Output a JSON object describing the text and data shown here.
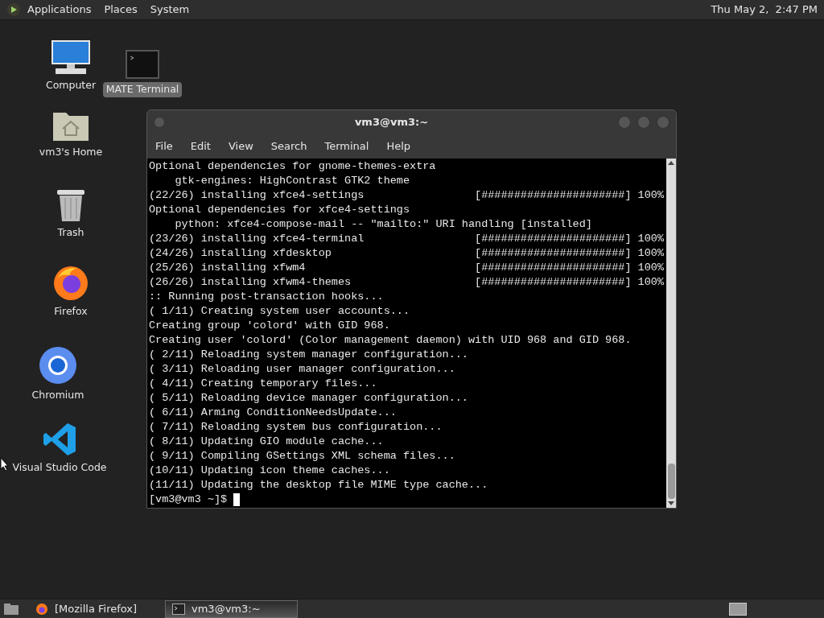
{
  "top_panel": {
    "menus": [
      "Applications",
      "Places",
      "System"
    ],
    "clock": "Thu May 2,  2:47 PM"
  },
  "desktop_icons": [
    {
      "kind": "computer",
      "label": "Computer",
      "selected": false
    },
    {
      "kind": "terminal",
      "label": "MATE Terminal",
      "selected": true
    },
    {
      "kind": "home",
      "label": "vm3's Home",
      "selected": false
    },
    {
      "kind": "trash",
      "label": "Trash",
      "selected": false
    },
    {
      "kind": "firefox",
      "label": "Firefox",
      "selected": false
    },
    {
      "kind": "chromium",
      "label": "Chromium",
      "selected": false
    },
    {
      "kind": "vscode",
      "label": "Visual Studio Code",
      "selected": false
    }
  ],
  "terminal_window": {
    "title": "vm3@vm3:~",
    "menu": [
      "File",
      "Edit",
      "View",
      "Search",
      "Terminal",
      "Help"
    ],
    "lines": [
      "Optional dependencies for gnome-themes-extra",
      "    gtk-engines: HighContrast GTK2 theme",
      "(22/26) installing xfce4-settings                 [######################] 100%",
      "Optional dependencies for xfce4-settings",
      "    python: xfce4-compose-mail -- \"mailto:\" URI handling [installed]",
      "(23/26) installing xfce4-terminal                 [######################] 100%",
      "(24/26) installing xfdesktop                      [######################] 100%",
      "(25/26) installing xfwm4                          [######################] 100%",
      "(26/26) installing xfwm4-themes                   [######################] 100%",
      ":: Running post-transaction hooks...",
      "( 1/11) Creating system user accounts...",
      "Creating group 'colord' with GID 968.",
      "Creating user 'colord' (Color management daemon) with UID 968 and GID 968.",
      "( 2/11) Reloading system manager configuration...",
      "( 3/11) Reloading user manager configuration...",
      "( 4/11) Creating temporary files...",
      "( 5/11) Reloading device manager configuration...",
      "( 6/11) Arming ConditionNeedsUpdate...",
      "( 7/11) Reloading system bus configuration...",
      "( 8/11) Updating GIO module cache...",
      "( 9/11) Compiling GSettings XML schema files...",
      "(10/11) Updating icon theme caches...",
      "(11/11) Updating the desktop file MIME type cache..."
    ],
    "prompt": "[vm3@vm3 ~]$"
  },
  "taskbar": {
    "items": [
      {
        "label": "[Mozilla Firefox]",
        "kind": "firefox",
        "selected": false
      },
      {
        "label": "vm3@vm3:~",
        "kind": "terminal",
        "selected": true
      }
    ]
  }
}
